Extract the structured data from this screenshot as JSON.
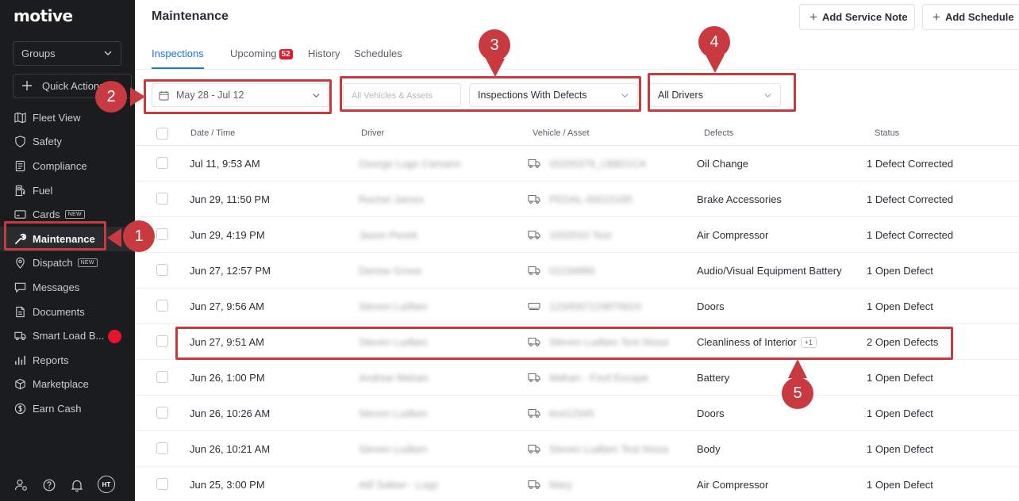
{
  "sidebar": {
    "logo": "motive",
    "groups_label": "Groups",
    "quick_actions_label": "Quick Actions",
    "items": [
      {
        "label": "Fleet View",
        "icon": "map-icon"
      },
      {
        "label": "Safety",
        "icon": "shield-icon"
      },
      {
        "label": "Compliance",
        "icon": "document-icon"
      },
      {
        "label": "Fuel",
        "icon": "fuel-pump-icon"
      },
      {
        "label": "Cards",
        "icon": "card-icon",
        "badge": "NEW"
      },
      {
        "label": "Maintenance",
        "icon": "wrench-icon",
        "active": true
      },
      {
        "label": "Dispatch",
        "icon": "location-pin-icon",
        "badge": "NEW"
      },
      {
        "label": "Messages",
        "icon": "chat-icon"
      },
      {
        "label": "Documents",
        "icon": "file-icon"
      },
      {
        "label": "Smart Load B...",
        "icon": "truck-icon",
        "dot": true
      },
      {
        "label": "Reports",
        "icon": "bar-chart-icon"
      },
      {
        "label": "Marketplace",
        "icon": "cube-icon"
      },
      {
        "label": "Earn Cash",
        "icon": "dollar-icon"
      }
    ],
    "avatar_initials": "HT"
  },
  "header": {
    "title": "Maintenance",
    "add_service_note": "Add Service Note",
    "add_schedule": "Add Schedule"
  },
  "tabs": [
    {
      "label": "Inspections",
      "active": true
    },
    {
      "label": "Upcoming",
      "count": "52"
    },
    {
      "label": "History"
    },
    {
      "label": "Schedules"
    }
  ],
  "filters": {
    "date_range": "May 28 - Jul 12",
    "vehicles_placeholder": "All Vehicles & Assets",
    "defects_filter": "Inspections With Defects",
    "drivers_filter": "All Drivers"
  },
  "table": {
    "columns": [
      "Date / Time",
      "Driver",
      "Vehicle / Asset",
      "Defects",
      "Status"
    ],
    "rows": [
      {
        "date": "Jul 11, 9:53 AM",
        "driver": "George Logo Camann",
        "vehicle": "00200378_LBB01CA",
        "vehicle_type": "truck",
        "defect": "Oil Change",
        "status": "1 Defect Corrected"
      },
      {
        "date": "Jun 29, 11:50 PM",
        "driver": "Rachel James",
        "vehicle": "PEDAL-00015185",
        "vehicle_type": "truck",
        "defect": "Brake Accessories",
        "status": "1 Defect Corrected"
      },
      {
        "date": "Jun 29, 4:19 PM",
        "driver": "Jason Pexek",
        "vehicle": "1002010 Test",
        "vehicle_type": "truck",
        "defect": "Air Compressor",
        "status": "1 Defect Corrected"
      },
      {
        "date": "Jun 27, 12:57 PM",
        "driver": "Denise Grove",
        "vehicle": "01234880",
        "vehicle_type": "truck",
        "defect": "Audio/Visual Equipment Battery",
        "status": "1 Open Defect"
      },
      {
        "date": "Jun 27, 9:56 AM",
        "driver": "Steven Ludlam",
        "vehicle": "1234567124876624",
        "vehicle_type": "trailer",
        "defect": "Doors",
        "status": "1 Open Defect"
      },
      {
        "date": "Jun 27, 9:51 AM",
        "driver": "Steven Ludlam",
        "vehicle": "Steven Ludlam Test Nissan",
        "vehicle_type": "truck",
        "defect": "Cleanliness of Interior",
        "defect_extra": "+1",
        "status": "2 Open Defects"
      },
      {
        "date": "Jun 26, 1:00 PM",
        "driver": "Andrew Mahan",
        "vehicle": "Mahan - Ford Escape",
        "vehicle_type": "truck",
        "defect": "Battery",
        "status": "1 Open Defect"
      },
      {
        "date": "Jun 26, 10:26 AM",
        "driver": "Steven Ludlam",
        "vehicle": "test12345",
        "vehicle_type": "truck",
        "defect": "Doors",
        "status": "1 Open Defect"
      },
      {
        "date": "Jun 26, 10:21 AM",
        "driver": "Steven Ludlam",
        "vehicle": "Steven Ludlam Test Nissan",
        "vehicle_type": "truck",
        "defect": "Body",
        "status": "1 Open Defect"
      },
      {
        "date": "Jun 25, 3:00 PM",
        "driver": "Atif Safeer - Logs",
        "vehicle": "Mary",
        "vehicle_type": "truck",
        "defect": "Air Compressor",
        "status": "1 Open Defect"
      }
    ]
  },
  "annotations": {
    "callouts": [
      "1",
      "2",
      "3",
      "4",
      "5"
    ],
    "color": "#c83a3f"
  },
  "colors": {
    "sidebar_bg": "#1b1c1e",
    "accent_blue": "#1a73e8",
    "badge_red": "#e8142a"
  }
}
